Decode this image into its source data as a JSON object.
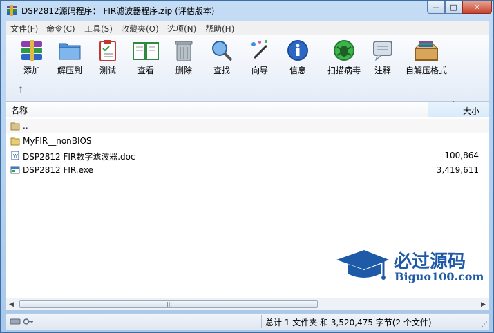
{
  "window": {
    "title": "DSP2812源码程序： FIR滤波器程序.zip (评估版本)",
    "min_label": "—",
    "max_label": "□",
    "close_label": "✕"
  },
  "menu": [
    "文件(F)",
    "命令(C)",
    "工具(S)",
    "收藏夹(O)",
    "选项(N)",
    "帮助(H)"
  ],
  "toolbar": [
    {
      "label": "添加",
      "icon": "add-archive-icon"
    },
    {
      "label": "解压到",
      "icon": "extract-folder-icon"
    },
    {
      "label": "测试",
      "icon": "test-clipboard-icon"
    },
    {
      "label": "查看",
      "icon": "view-book-icon"
    },
    {
      "label": "删除",
      "icon": "trash-icon"
    },
    {
      "label": "查找",
      "icon": "magnifier-icon"
    },
    {
      "label": "向导",
      "icon": "wizard-wand-icon"
    },
    {
      "label": "信息",
      "icon": "info-icon"
    },
    {
      "label": "扫描病毒",
      "icon": "virus-scan-icon"
    },
    {
      "label": "注释",
      "icon": "comment-icon"
    },
    {
      "label": "自解压格式",
      "icon": "sfx-box-icon"
    }
  ],
  "up_arrow": "↑",
  "list": {
    "col_name": "名称",
    "col_size": "大小",
    "sort_arrow": "ˆ",
    "rows": [
      {
        "name": "..",
        "size": "",
        "icon": "parent-folder-icon"
      },
      {
        "name": "MyFIR__nonBIOS",
        "size": "",
        "icon": "folder-icon"
      },
      {
        "name": "DSP2812 FIR数字滤波器.doc",
        "size": "100,864",
        "icon": "word-doc-icon"
      },
      {
        "name": "DSP2812 FIR.exe",
        "size": "3,419,611",
        "icon": "exe-icon"
      }
    ]
  },
  "watermark": {
    "line1": "必过源码",
    "line2": "Biguo100.com"
  },
  "scroll": {
    "left": "◀",
    "right": "▶",
    "grip": "|||"
  },
  "status": {
    "text": "总计 1 文件夹 和 3,520,475 字节(2 个文件)",
    "grip": "⋰"
  },
  "colors": {
    "accent": "#1e5aa8",
    "close": "#c7432e"
  }
}
